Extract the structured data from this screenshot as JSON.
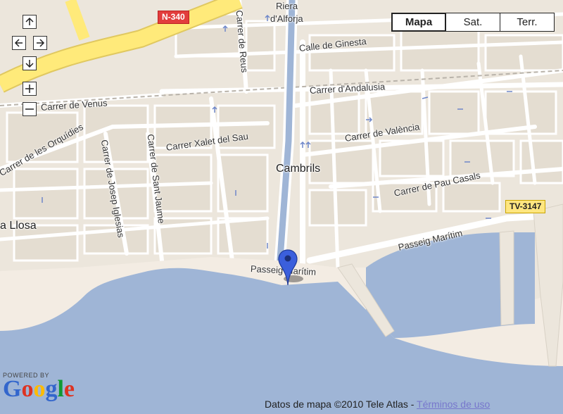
{
  "map": {
    "controls": {
      "pan_up": "pan up",
      "pan_left": "pan left",
      "pan_right": "pan right",
      "pan_down": "pan down",
      "zoom_in": "zoom in",
      "zoom_out": "zoom out"
    },
    "map_types": [
      "Mapa",
      "Sat.",
      "Terr."
    ],
    "active_map_type": "Mapa",
    "shields": {
      "n340": "N-340",
      "tv3147": "TV-3147"
    },
    "places": {
      "city": "Cambrils",
      "riera_line1": "Riera",
      "riera_line2": "d'Alforja",
      "la_llosa": "a Llosa"
    },
    "streets": {
      "ginesta": "Calle de Ginesta",
      "andalusia": "Carrer d'Andalusia",
      "venus": "Carrer de Venus",
      "valencia": "Carrer de València",
      "xalet": "Carrer Xalet del Sau",
      "orquidies": "Carrer de les Orquídies",
      "josep_iglesias": "Carrer de Josep Iglesias",
      "sant_jaume": "Carrer de Sant Jaume",
      "reus": "Carrer de Reus",
      "pau_casals": "Carrer de Pau Casals",
      "passeig_maritim_1": "Passeig Marítim",
      "passeig_maritim_2": "Passeig Marítim"
    },
    "attribution": "Datos de mapa ©2010 Tele Atlas - ",
    "terms": "Términos de uso",
    "logo": {
      "powered": "POWERED BY",
      "google": "Google"
    },
    "colors": {
      "land": "#ece6dc",
      "street": "#ffffff",
      "water": "#9fb5d6",
      "beach": "#f3ece3",
      "highway": "#ffea7a",
      "marker": "#3b5fdc"
    }
  }
}
